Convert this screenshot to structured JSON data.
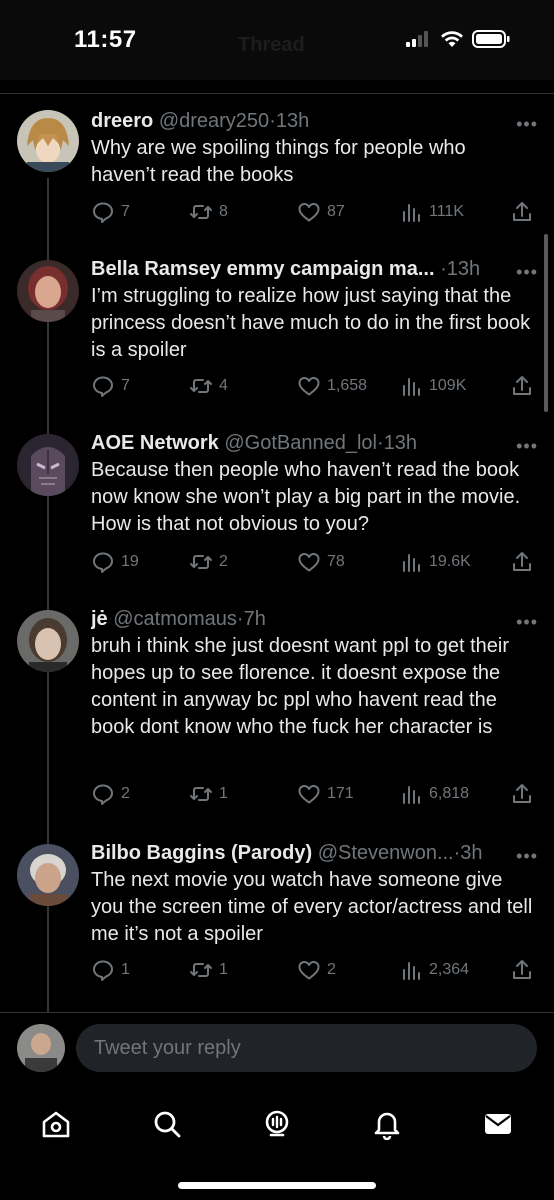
{
  "status_bar": {
    "time": "11:57",
    "header_title": "Thread"
  },
  "colors": {
    "background": "#000000",
    "text": "#e7e9ea",
    "muted": "#71767b",
    "divider": "#2f3336"
  },
  "tweets": [
    {
      "name": "dreero",
      "handle": "@dreary250",
      "sep": "·",
      "time": "13h",
      "text": "Why are we spoiling things for people who haven’t read the books",
      "replies": "7",
      "retweets": "8",
      "likes": "87",
      "views": "111K",
      "avatar_icon": "anime-avatar"
    },
    {
      "name": "Bella Ramsey emmy campaign ma...",
      "handle": "",
      "sep": "·",
      "time": "13h",
      "text": "I’m struggling to realize how just saying that the princess doesn’t have much to do in the first book is a spoiler",
      "replies": "7",
      "retweets": "4",
      "likes": "1,658",
      "views": "109K",
      "avatar_icon": "person-avatar"
    },
    {
      "name": "AOE Network",
      "handle": "@GotBanned_lol",
      "sep": "·",
      "time": "13h",
      "text": "Because then people who haven’t read the book now know she won’t play a big part in the movie. How is that not obvious to you?",
      "replies": "19",
      "retweets": "2",
      "likes": "78",
      "views": "19.6K",
      "avatar_icon": "titan-avatar"
    },
    {
      "name": "jė",
      "handle": "@catmomaus",
      "sep": "·",
      "time": "7h",
      "text": "bruh i think she just doesnt want ppl to get their hopes up to see florence. it doesnt expose the content in anyway bc ppl who havent read the book dont know who the fuck her character is",
      "replies": "2",
      "retweets": "1",
      "likes": "171",
      "views": "6,818",
      "avatar_icon": "person-avatar"
    },
    {
      "name": "Bilbo Baggins (Parody)",
      "handle": "@Stevenwon...",
      "sep": "·",
      "time": "3h",
      "text": "The next movie you watch have someone give you the screen time of every actor/actress and tell me it’s not a spoiler",
      "replies": "1",
      "retweets": "1",
      "likes": "2",
      "views": "2,364",
      "avatar_icon": "person-avatar"
    }
  ],
  "reply_bar": {
    "placeholder": "Tweet your reply"
  },
  "tab_bar": {
    "items": [
      "home-icon",
      "search-icon",
      "spaces-icon",
      "notifications-icon",
      "messages-icon"
    ]
  }
}
